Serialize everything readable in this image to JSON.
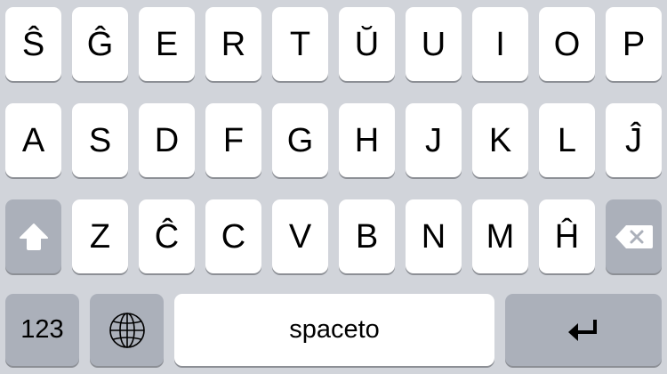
{
  "keyboard": {
    "row1": [
      "Ŝ",
      "Ĝ",
      "E",
      "R",
      "T",
      "Ŭ",
      "U",
      "I",
      "O",
      "P"
    ],
    "row2": [
      "A",
      "S",
      "D",
      "F",
      "G",
      "H",
      "J",
      "K",
      "L",
      "Ĵ"
    ],
    "row3": [
      "Z",
      "Ĉ",
      "C",
      "V",
      "B",
      "N",
      "M",
      "Ĥ"
    ],
    "numbers_label": "123",
    "space_label": "spaceto",
    "icons": {
      "shift": "shift-arrow-icon",
      "delete": "backspace-icon",
      "globe": "globe-icon",
      "return": "return-arrow-icon"
    },
    "colors": {
      "background": "#d1d4da",
      "key": "#ffffff",
      "function_key": "#abb0ba"
    }
  }
}
